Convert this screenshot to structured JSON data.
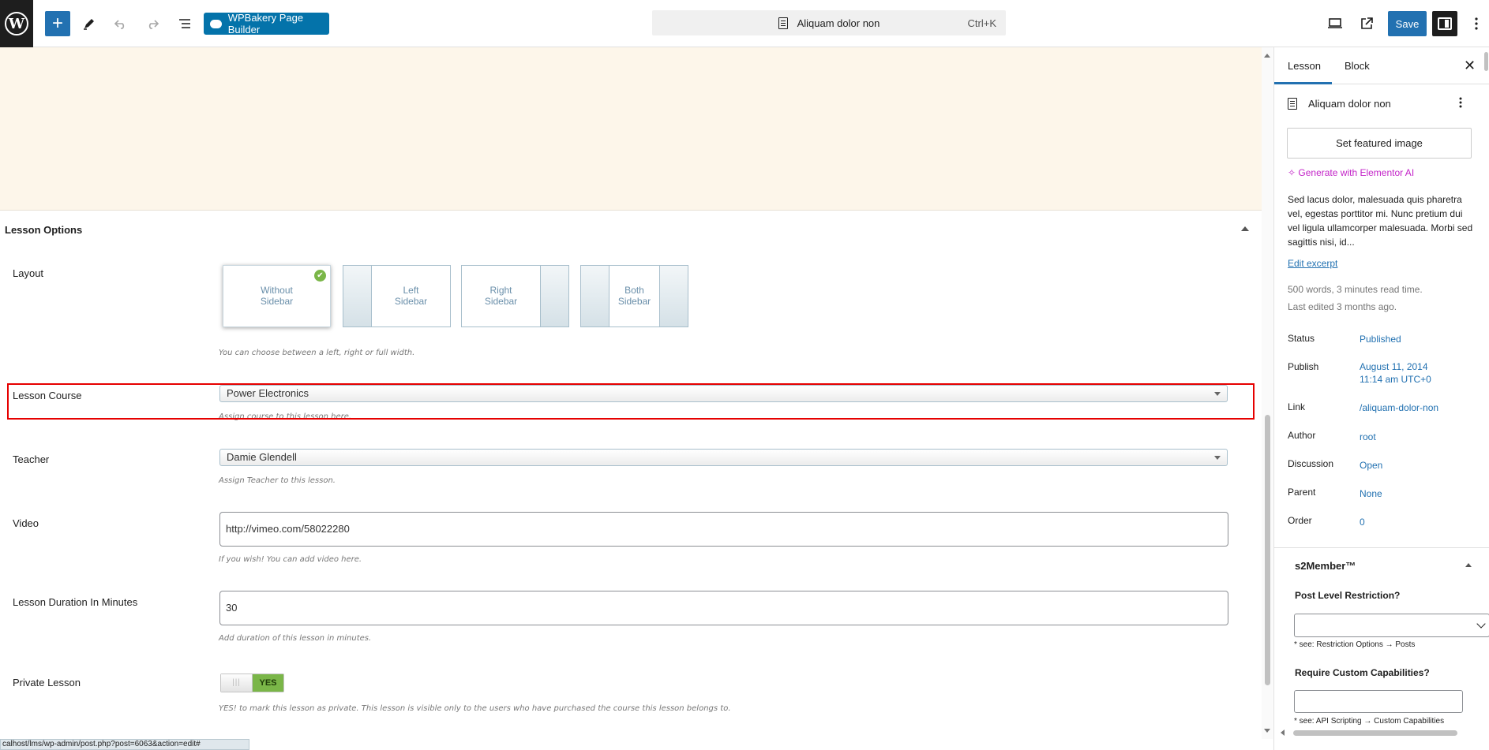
{
  "toolbar": {
    "wp_logo": "W",
    "wpbakery_label": "WPBakery Page Builder",
    "command_title": "Aliquam dolor non",
    "command_shortcut": "Ctrl+K",
    "save_label": "Save",
    "icons": [
      "add-block-icon",
      "pen-tool-icon",
      "undo-icon",
      "redo-icon",
      "document-overview-icon",
      "desktop-preview-icon",
      "external-view-icon",
      "settings-panel-icon"
    ]
  },
  "lesson_options": {
    "title": "Lesson Options",
    "layout": {
      "label": "Layout",
      "options": [
        {
          "label": "Without Sidebar",
          "selected": true
        },
        {
          "label": "Left Sidebar",
          "selected": false
        },
        {
          "label": "Right Sidebar",
          "selected": false
        },
        {
          "label": "Both Sidebar",
          "selected": false
        }
      ],
      "hint": "You can choose between a left, right or full width."
    },
    "course": {
      "label": "Lesson Course",
      "value": "Power Electronics",
      "hint": "Assign course to this lesson here."
    },
    "teacher": {
      "label": "Teacher",
      "value": "Damie Glendell",
      "hint": "Assign Teacher to this lesson."
    },
    "video": {
      "label": "Video",
      "value": "http://vimeo.com/58022280",
      "hint": "If you wish! You can add video here."
    },
    "duration": {
      "label": "Lesson Duration In Minutes",
      "value": "30",
      "hint": "Add duration of this lesson in minutes."
    },
    "private": {
      "label": "Private Lesson",
      "toggle_on": "YES",
      "toggle_off": "|||",
      "hint": "YES! to mark this lesson as private. This lesson is visible only to the users who have purchased the course this lesson belongs to."
    }
  },
  "status_url": "calhost/lms/wp-admin/post.php?post=6063&action=edit#",
  "sidebar": {
    "tabs": [
      "Lesson",
      "Block"
    ],
    "close": "✕",
    "doc_title": "Aliquam dolor non",
    "featured_image": "Set featured image",
    "generate_ai": "Generate with Elementor AI",
    "excerpt": "Sed lacus dolor, malesuada quis pharetra vel, egestas porttitor mi. Nunc pretium dui vel ligula ullamcorper malesuada. Morbi sed sagittis nisi, id...",
    "edit_excerpt": "Edit excerpt",
    "word_info": "500 words, 3 minutes read time.",
    "last_edited": "Last edited 3 months ago.",
    "fields": [
      {
        "label": "Status",
        "value": "Published"
      },
      {
        "label": "Publish",
        "value": "August 11, 2014",
        "value2": "11:14 am UTC+0"
      },
      {
        "label": "Link",
        "value": "/aliquam-dolor-non"
      },
      {
        "label": "Author",
        "value": "root"
      },
      {
        "label": "Discussion",
        "value": "Open"
      },
      {
        "label": "Parent",
        "value": "None"
      },
      {
        "label": "Order",
        "value": "0"
      }
    ],
    "s2member": {
      "title": "s2Member™",
      "restriction_label": "Post Level Restriction?",
      "restriction_note": "* see: Restriction Options → Posts",
      "capabilities_label": "Require Custom Capabilities?",
      "capabilities_note": "* see: API Scripting → Custom Capabilities"
    }
  }
}
